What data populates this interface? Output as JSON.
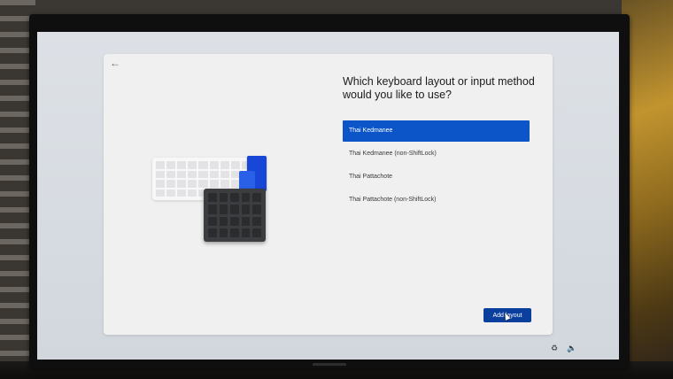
{
  "page": {
    "heading": "Which keyboard layout or input method would you like to use?"
  },
  "layouts": [
    {
      "label": "Thai Kedmanee",
      "selected": true
    },
    {
      "label": "Thai Kedmanee (non-ShiftLock)",
      "selected": false
    },
    {
      "label": "Thai Pattachote",
      "selected": false
    },
    {
      "label": "Thai Pattachote (non-ShiftLock)",
      "selected": false
    }
  ],
  "buttons": {
    "add_layout": "Add layout"
  },
  "icons": {
    "back": "back-arrow-icon",
    "accessibility": "accessibility-icon",
    "volume": "volume-icon"
  },
  "colors": {
    "accent": "#0b55c8",
    "button": "#0a3f9e",
    "card": "#f0f0f0",
    "screen": "#d6dbe1"
  }
}
